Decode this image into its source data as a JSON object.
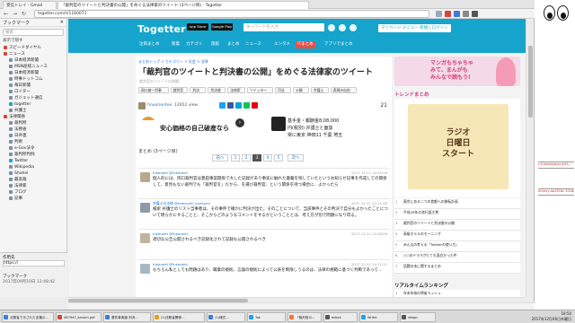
{
  "browser": {
    "window_title": "「裁判官のツイートと判決書の公開」をめぐる法律家のツイート (3ページ目) - Togetter",
    "tabs": [
      {
        "label": "受信トレイ - Gmail"
      },
      {
        "label": "「裁判官のツイートと判決書の公開」をめぐる法律家のツイート (3ページ目) - Togetter"
      }
    ],
    "url": "togetter.com/li/1160071",
    "search_placeholder": "検索"
  },
  "sidebar": {
    "title": "ブックマーク",
    "search_placeholder": "検索",
    "filter_label": "表示で隠す",
    "items": [
      {
        "label": "スピードダイヤル",
        "color": "#d9443a"
      },
      {
        "label": "ニュース",
        "color": "#d9443a"
      },
      {
        "label": "日本経済新聞",
        "color": "#7a8fa8"
      },
      {
        "label": "MSN産経ニュース",
        "color": "#7a8fa8"
      },
      {
        "label": "日本経済新聞",
        "color": "#7a8fa8"
      },
      {
        "label": "時事ドットコム",
        "color": "#7a8fa8"
      },
      {
        "label": "毎日新聞",
        "color": "#7a8fa8"
      },
      {
        "label": "ロイター",
        "color": "#7a8fa8"
      },
      {
        "label": "ガジェット通信",
        "color": "#7a8fa8"
      },
      {
        "label": "togetter",
        "color": "#17a4cc"
      },
      {
        "label": "弁護士",
        "color": "#7a8fa8"
      },
      {
        "label": "法律関係",
        "color": "#d9443a"
      },
      {
        "label": "裁判所",
        "color": "#7a8fa8"
      },
      {
        "label": "法務省",
        "color": "#7a8fa8"
      },
      {
        "label": "日弁連",
        "color": "#7a8fa8"
      },
      {
        "label": "判例",
        "color": "#7a8fa8"
      },
      {
        "label": "e-Gov法令",
        "color": "#7a8fa8"
      },
      {
        "label": "裁判所判例",
        "color": "#7a8fa8"
      },
      {
        "label": "Twitter",
        "color": "#1da1f2"
      },
      {
        "label": "Wikipedia",
        "color": "#7a8fa8"
      },
      {
        "label": "Shohei",
        "color": "#7a8fa8"
      },
      {
        "label": "最高裁",
        "color": "#7a8fa8"
      },
      {
        "label": "法律家",
        "color": "#7a8fa8"
      },
      {
        "label": "ブログ",
        "color": "#7a8fa8"
      },
      {
        "label": "記事",
        "color": "#7a8fa8"
      }
    ],
    "footer": {
      "lines": [
        "作用先",
        "https://",
        "",
        "ブックマーク",
        "2017年09月10日 12:48:42"
      ]
    }
  },
  "site": {
    "logo": "Togetter",
    "store_badges": [
      "App Store",
      "Google Play"
    ],
    "search_placeholder": "キーワードを入力",
    "login_label": "マイページ メニュー 新規 | ログイン",
    "categories": [
      {
        "label": "注目まとめ"
      },
      {
        "label": "新着"
      },
      {
        "label": "カテゴリ"
      },
      {
        "label": "旅館"
      },
      {
        "label": "まとめ"
      },
      {
        "label": "ニュース"
      },
      {
        "label": "エンタメ"
      },
      {
        "label": "ITまとめ"
      },
      {
        "label": "アプリでまとめ"
      }
    ]
  },
  "article": {
    "breadcrumb": "まとめトップ > カテゴリー > 社会 > 法律",
    "title": "「裁判官のツイートと判決書の公開」をめぐる法律家のツイート",
    "subtitle": "裁判官のツイートの問題",
    "tags": [
      "岡口基一判事",
      "裁判官",
      "判決",
      "判決書",
      "法律家",
      "ツイッター",
      "司法",
      "公開",
      "弁護士",
      "表現の自由"
    ],
    "author": "hnuorientee",
    "views": "12652 view",
    "fav_count": "21",
    "matome_label": "まとめ (3ページ目)",
    "pager": {
      "prev": "前へ",
      "pages": [
        "1",
        "2",
        "3",
        "4",
        "5"
      ],
      "current": "3",
      "next": "次へ"
    }
  },
  "ad": {
    "left_text": "安心価格の自己破産なら",
    "right_lines": [
      "基手金・報酬金8,08,000",
      "円(税別) 弁護士と面談",
      "常に東京 神田11 千葉 埼玉"
    ]
  },
  "tweets": [
    {
      "user": "fukorantl @fukorantl",
      "date": "2017.12.11 14:29:16",
      "text": "個人的には、岡口裁判官は豊田事案関係で大した記録があり事実に触れた書籍を残していたというお知らせ記事を作成しての関係して、意見もない裁判でも「裁判官を」だから、を選び裁判官、という関係を持つ場合に、よかったら"
    },
    {
      "user": "弁護士の法律 @tomoyuki_tsutsumi",
      "date": "2017.12.11 12:11:46",
      "text": "検索 弁護士のリスト当事者は、その事件で確かに判決が出た。そのことについて、当該事件とその判決で自分もよかったことについて明らかにすることと、そこからどのようなコメントをするかということとは、考え方が別で問題になり得る。"
    },
    {
      "user": "fukorantl @fukorantl",
      "date": "2017.12.11 14:28:56",
      "text": "適切な公告公開されるべき記録化されて記録も公開されるべき"
    },
    {
      "user": "fukorantl @fukorantl",
      "date": "2017.12.11 14:31:11",
      "text": "もちろん私としても問題はあり、職業の規則、言論の規則によって公表を制限しうるのは、法律の規範に基づく判断であって…"
    }
  ],
  "right": {
    "promo_text": [
      "マンガもちゃちゃ",
      "みて、まんがも",
      "みんなで読もう!"
    ],
    "trend_heading": "トレンドまとめ",
    "bigad_text": [
      "ラジオ",
      "日曜日",
      "スタート"
    ],
    "rankings": [
      {
        "no": "1",
        "text": "東京にある二つの首都への移転計画"
      },
      {
        "no": "2",
        "text": "平成29年の流行語大賞"
      },
      {
        "no": "3",
        "text": "裁判官のツイートと判決書の公開"
      },
      {
        "no": "4",
        "text": "高級ホテルのモーニング"
      },
      {
        "no": "5",
        "text": "みんなの考える「Twitterの使い方」"
      },
      {
        "no": "6",
        "text": "○○のドラマがとても面白かった件"
      },
      {
        "no": "7",
        "text": "話題の本に関するまとめ"
      }
    ],
    "realtime_heading": "リアルタイムランキング",
    "realtime": [
      {
        "no": "1",
        "text": "年末年始の帰省ラッシュ"
      },
      {
        "no": "2",
        "text": "地方選挙の開票速報まとめ"
      }
    ]
  },
  "overlay_notes": [
    {
      "text": "c:\\Users\\kalo\\c(sri)\\..."
    },
    {
      "text": "ei:terry-op2018c 2018/01"
    }
  ],
  "taskbar": {
    "tasks": [
      {
        "label": "法務省で示された言葉の...",
        "color": "#3b7dd8"
      },
      {
        "label": "087947_kanom.pdf",
        "color": "#d9443a"
      },
      {
        "label": "要件事実論 判決...",
        "color": "#3b7dd8"
      },
      {
        "label": "(1)法務省関係...",
        "color": "#e5a020"
      },
      {
        "label": "(1)様式...",
        "color": "#3b7dd8"
      },
      {
        "label": "Tak",
        "color": "#1da1f2"
      },
      {
        "label": "「裁判官の...",
        "color": "#ff7139"
      },
      {
        "label": "adock",
        "color": "#555"
      },
      {
        "label": "Writer",
        "color": "#1da1f2"
      },
      {
        "label": "xkogn",
        "color": "#555"
      }
    ],
    "clock_time": "18:50",
    "clock_date": "2017年12月06日木曜日"
  }
}
